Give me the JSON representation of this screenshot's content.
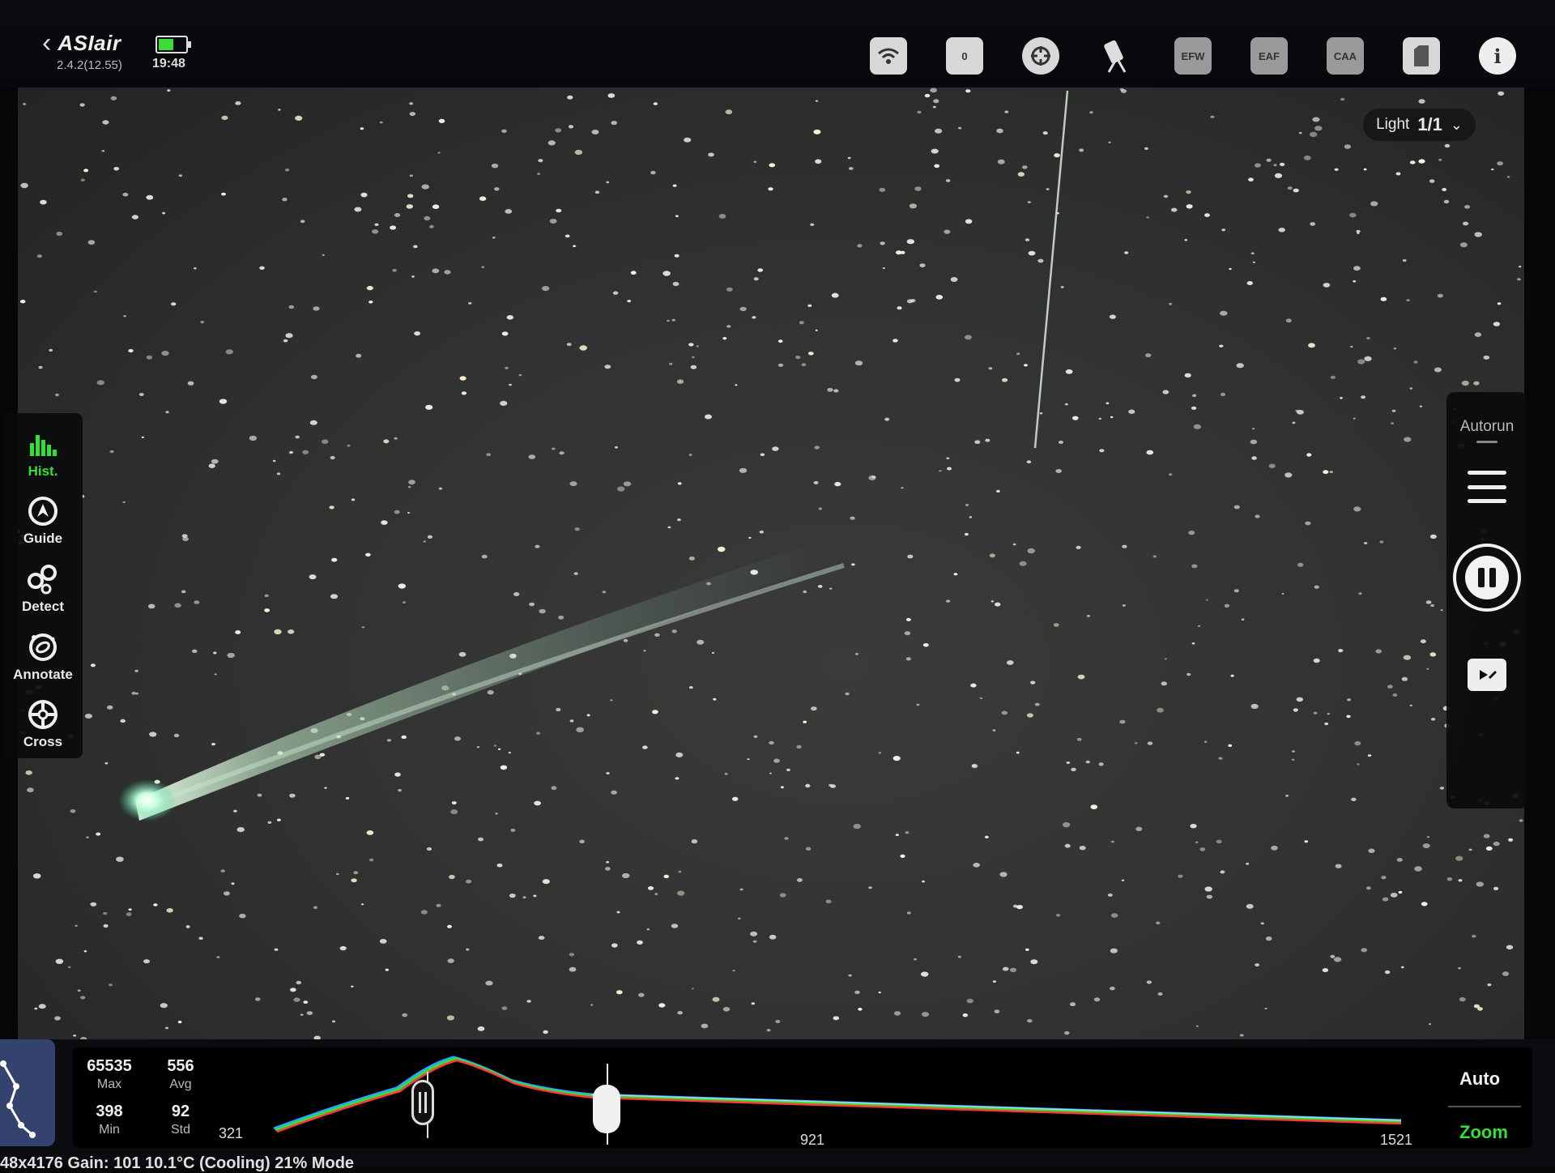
{
  "app": {
    "name": "ASIair",
    "version": "2.4.2(12.55)",
    "time": "19:48"
  },
  "battery": {
    "level": 0.6
  },
  "top_icons": [
    {
      "name": "wifi-icon",
      "label": ""
    },
    {
      "name": "camera-icon",
      "label": "0"
    },
    {
      "name": "guide-camera-icon",
      "label": ""
    },
    {
      "name": "telescope-icon",
      "label": ""
    },
    {
      "name": "efw-icon",
      "label": "EFW"
    },
    {
      "name": "eaf-icon",
      "label": "EAF"
    },
    {
      "name": "caa-icon",
      "label": "CAA"
    },
    {
      "name": "storage-icon",
      "label": ""
    },
    {
      "name": "info-icon",
      "label": "i"
    }
  ],
  "frame": {
    "type_label": "Light",
    "count": "1/1"
  },
  "left_tools": [
    {
      "label": "Hist.",
      "icon": "histogram-icon",
      "active": true
    },
    {
      "label": "Guide",
      "icon": "guide-icon",
      "active": false
    },
    {
      "label": "Detect",
      "icon": "detect-icon",
      "active": false
    },
    {
      "label": "Annotate",
      "icon": "annotate-icon",
      "active": false
    },
    {
      "label": "Cross",
      "icon": "crosshair-icon",
      "active": false
    }
  ],
  "right_panel": {
    "autorun_label": "Autorun"
  },
  "histogram": {
    "stats": {
      "max": "65535",
      "max_label": "Max",
      "avg": "556",
      "avg_label": "Avg",
      "min": "398",
      "min_label": "Min",
      "std": "92",
      "std_label": "Std"
    },
    "ticks": [
      "321",
      "921",
      "1521"
    ],
    "auto_label": "Auto",
    "zoom_label": "Zoom",
    "colors": {
      "accent": "#35e035"
    }
  },
  "status_bar": {
    "text": "48x4176   Gain: 101    10.1°C (Cooling) 21%  Mode"
  }
}
